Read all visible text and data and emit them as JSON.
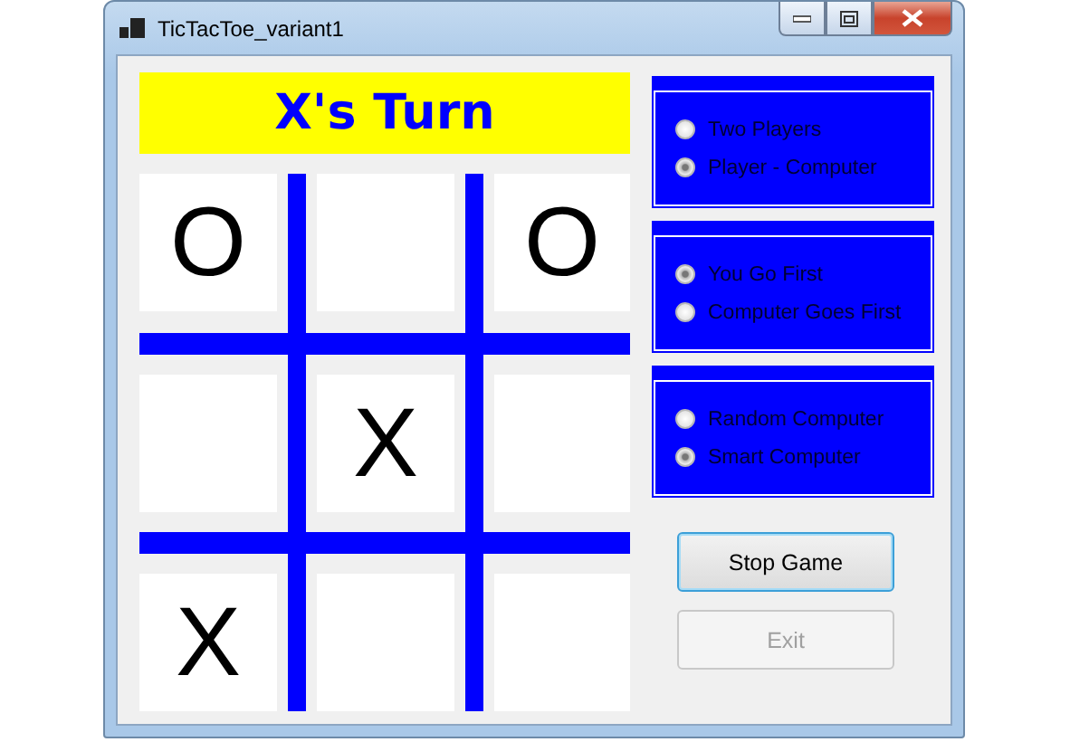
{
  "window": {
    "title": "TicTacToe_variant1"
  },
  "turn_banner": "X's Turn",
  "board": [
    {
      "kind": "mark",
      "mark": "O"
    },
    {
      "kind": "blank"
    },
    {
      "kind": "mark",
      "mark": "O"
    },
    {
      "kind": "blank"
    },
    {
      "kind": "mark",
      "mark": "X"
    },
    {
      "kind": "blank"
    },
    {
      "kind": "mark",
      "mark": "X"
    },
    {
      "kind": "blank"
    },
    {
      "kind": "blank"
    }
  ],
  "option_groups": [
    {
      "options": [
        {
          "label": "Two Players",
          "selected": false
        },
        {
          "label": "Player - Computer",
          "selected": true
        }
      ]
    },
    {
      "options": [
        {
          "label": "You Go First",
          "selected": true
        },
        {
          "label": "Computer Goes First",
          "selected": false
        }
      ]
    },
    {
      "options": [
        {
          "label": "Random Computer",
          "selected": false
        },
        {
          "label": "Smart Computer",
          "selected": true
        }
      ]
    }
  ],
  "buttons": [
    {
      "label": "Stop Game",
      "focused": true,
      "disabled": false
    },
    {
      "label": "Exit",
      "focused": false,
      "disabled": true
    }
  ]
}
